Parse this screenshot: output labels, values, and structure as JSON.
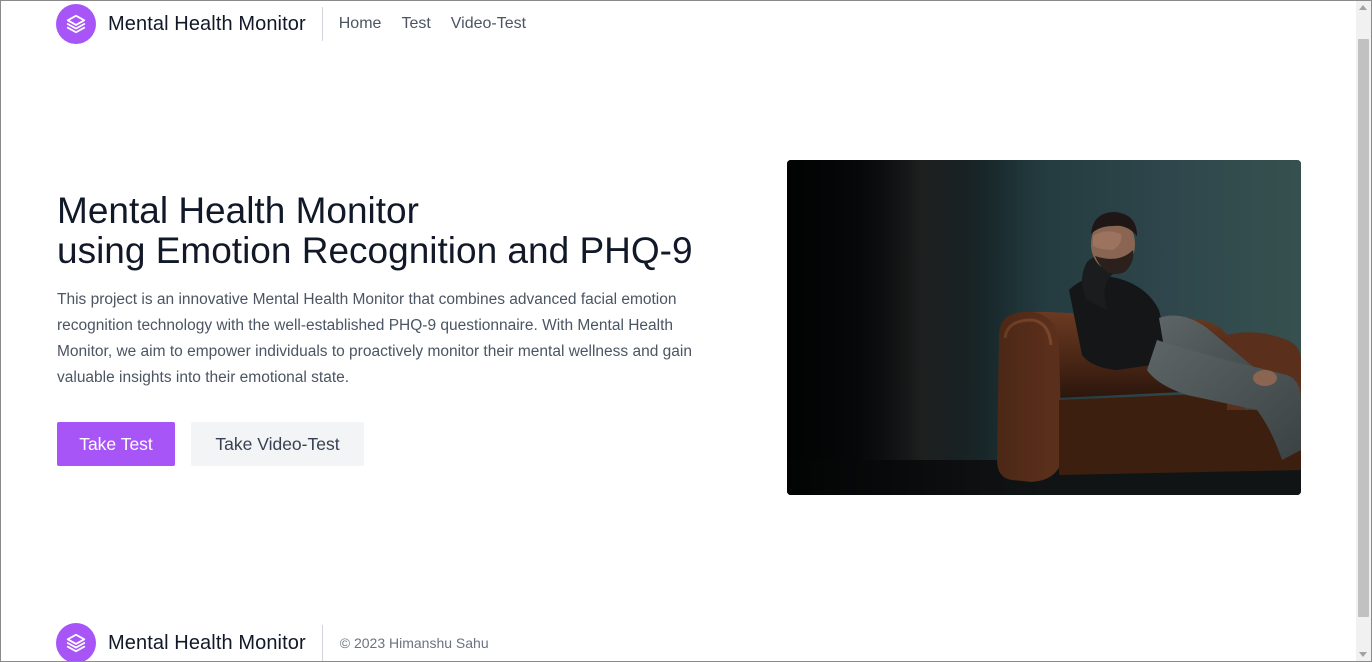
{
  "header": {
    "brand": "Mental Health Monitor",
    "nav": [
      "Home",
      "Test",
      "Video-Test"
    ]
  },
  "hero": {
    "title_line1": "Mental Health Monitor",
    "title_line2": "using Emotion Recognition and PHQ-9",
    "description": "This project is an innovative Mental Health Monitor that combines advanced facial emotion recognition technology with the well-established PHQ-9 questionnaire. With Mental Health Monitor, we aim to empower individuals to proactively monitor their mental wellness and gain valuable insights into their emotional state.",
    "primary_button": "Take Test",
    "secondary_button": "Take Video-Test",
    "image_subject": "man sitting on leather armchair holding head"
  },
  "footer": {
    "brand": "Mental Health Monitor",
    "copyright": "© 2023 Himanshu Sahu"
  },
  "colors": {
    "accent": "#a855f7",
    "text_dark": "#111827",
    "text_muted": "#4b5563",
    "secondary_button_bg": "#f3f4f6"
  },
  "icons": {
    "logo": "layers-icon"
  }
}
